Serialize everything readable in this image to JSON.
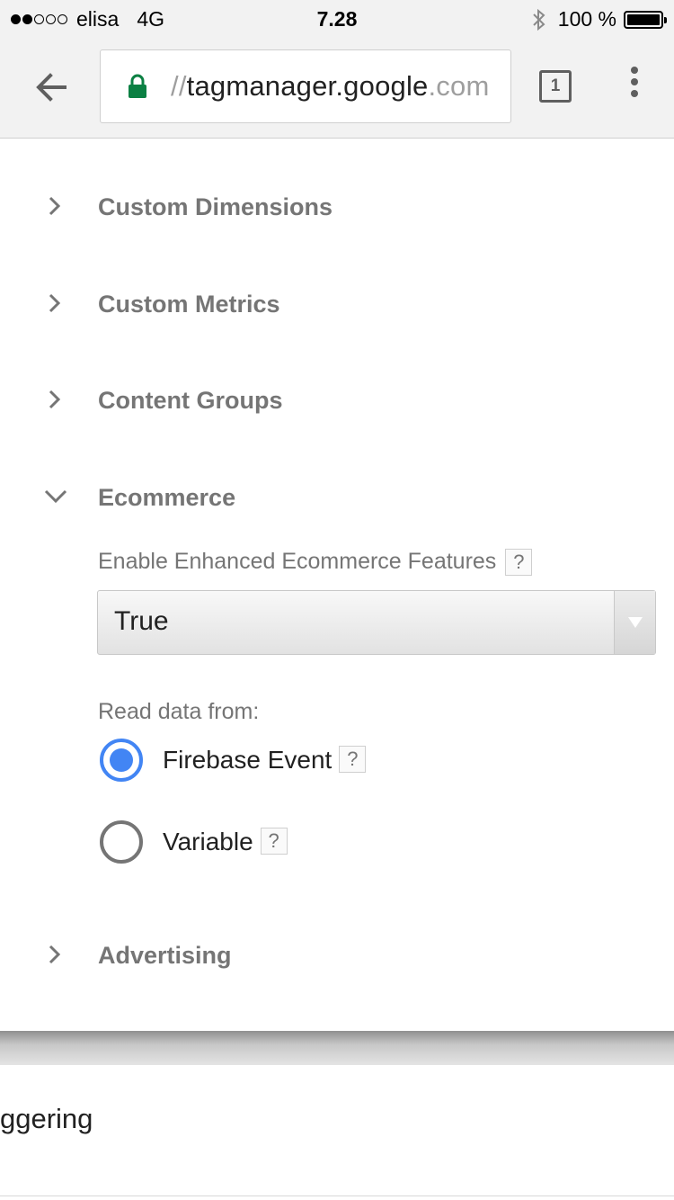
{
  "status_bar": {
    "carrier": "elisa",
    "network": "4G",
    "time": "7.28",
    "battery": "100 %",
    "signal_bars_filled": 2,
    "signal_bars_total": 5
  },
  "browser": {
    "url_prefix": "//",
    "url_host": "tagmanager.google",
    "url_suffix": ".com",
    "tab_count": "1",
    "icons": {
      "back": "arrow-left-icon",
      "lock": "lock-icon",
      "tabs": "tab-switcher-icon",
      "menu": "overflow-menu-icon"
    },
    "lock_color": "#0b8043"
  },
  "sections": {
    "custom_dimensions": "Custom Dimensions",
    "custom_metrics": "Custom Metrics",
    "content_groups": "Content Groups",
    "ecommerce": "Ecommerce",
    "advertising": "Advertising"
  },
  "ecommerce": {
    "enhanced_label": "Enable Enhanced Ecommerce Features",
    "enhanced_value": "True",
    "help_glyph": "?",
    "read_data_label": "Read data from:",
    "options": [
      {
        "label": "Firebase Event",
        "selected": true
      },
      {
        "label": "Variable",
        "selected": false
      }
    ]
  },
  "bottom": {
    "text": "ggering"
  },
  "colors": {
    "accent": "#4285f4",
    "muted_text": "#757575"
  }
}
